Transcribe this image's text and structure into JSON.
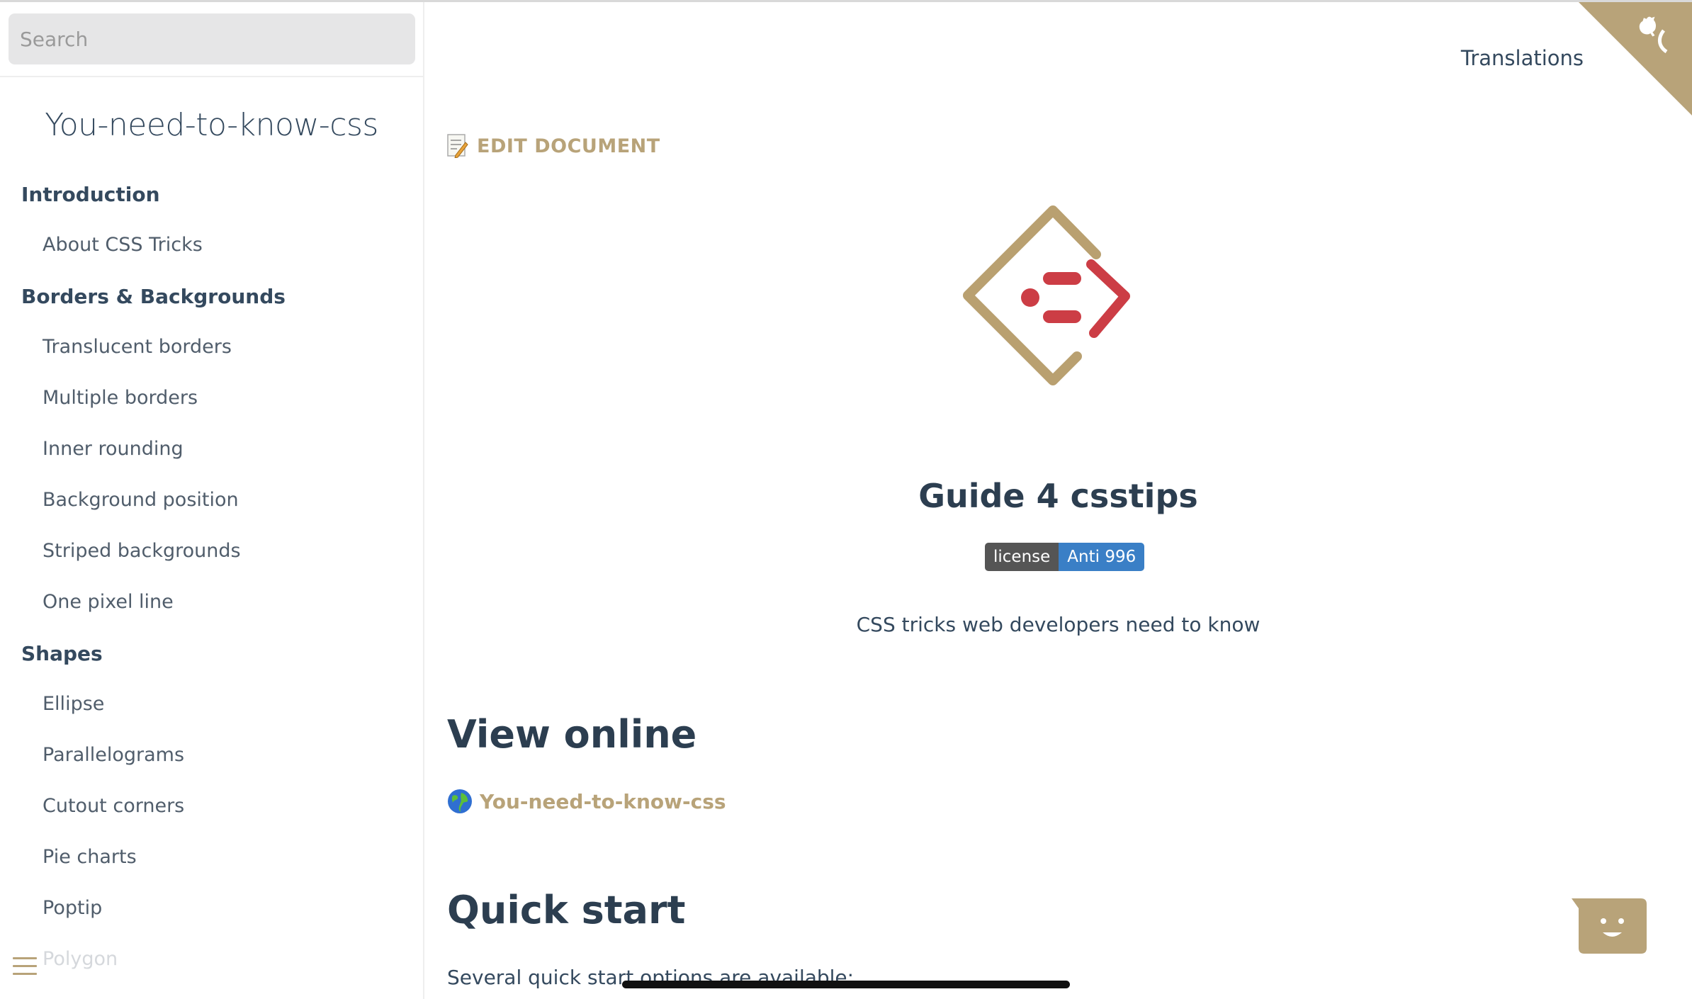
{
  "search": {
    "placeholder": "Search"
  },
  "app": {
    "name": "You-need-to-know-css"
  },
  "sidebar": {
    "sections": [
      {
        "title": "Introduction",
        "items": [
          "About CSS Tricks"
        ]
      },
      {
        "title": "Borders & Backgrounds",
        "items": [
          "Translucent borders",
          "Multiple borders",
          "Inner rounding",
          "Background position",
          "Striped backgrounds",
          "One pixel line"
        ]
      },
      {
        "title": "Shapes",
        "items": [
          "Ellipse",
          "Parallelograms",
          "Cutout corners",
          "Pie charts",
          "Poptip",
          "Polygon"
        ]
      }
    ]
  },
  "header": {
    "translations": "Translations"
  },
  "main": {
    "edit_label": "EDIT DOCUMENT",
    "title": "Guide 4 csstips",
    "badge": {
      "left": "license",
      "right": "Anti 996"
    },
    "tagline": "CSS tricks web developers need to know",
    "view_online_heading": "View online",
    "online_link": "You-need-to-know-css",
    "quick_start_heading": "Quick start",
    "quick_start_text": "Several quick start options are available:"
  },
  "colors": {
    "accent": "#b8a379",
    "text": "#34495e",
    "badge_blue": "#3a7fc6",
    "badge_gray": "#555555",
    "logo_red": "#cc3d45"
  },
  "icons": [
    "github-corner-icon",
    "edit-document-icon",
    "globe-icon",
    "chat-bot-icon",
    "menu-icon",
    "logo-icon"
  ]
}
